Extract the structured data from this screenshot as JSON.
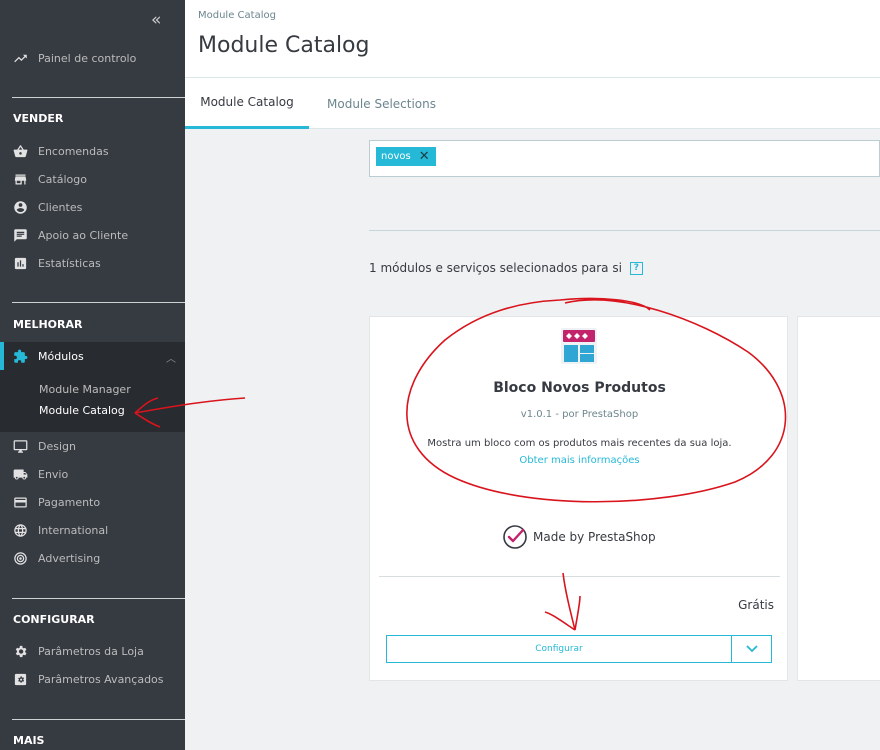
{
  "sidebar": {
    "collapse_glyph": "«",
    "dashboard": "Painel de controlo",
    "sections": {
      "sell": "VENDER",
      "improve": "MELHORAR",
      "configure": "CONFIGURAR",
      "more": "MAIS"
    },
    "sell_items": [
      "Encomendas",
      "Catálogo",
      "Clientes",
      "Apoio ao Cliente",
      "Estatísticas"
    ],
    "modules": "Módulos",
    "module_sub": [
      "Module Manager",
      "Module Catalog"
    ],
    "improve_items": [
      "Design",
      "Envio",
      "Pagamento",
      "International",
      "Advertising"
    ],
    "configure_items": [
      "Parâmetros da Loja",
      "Parâmetros Avançados"
    ],
    "icons": [
      "trending-up-icon",
      "basket-icon",
      "store-icon",
      "user-icon",
      "chat-icon",
      "chart-icon",
      "puzzle-icon",
      "monitor-icon",
      "truck-icon",
      "card-icon",
      "globe-icon",
      "target-icon",
      "gear-icon",
      "settings-box-icon"
    ]
  },
  "header": {
    "breadcrumb": "Module Catalog",
    "title": "Module Catalog"
  },
  "tabs": [
    "Module Catalog",
    "Module Selections"
  ],
  "search": {
    "tag": "novos",
    "tag_remove": "✕"
  },
  "results": {
    "count_text": "1 módulos e serviços selecionados para si",
    "help": "?"
  },
  "module": {
    "name": "Bloco Novos Produtos",
    "version": "v1.0.1 - por PrestaShop",
    "description": "Mostra um bloco com os produtos mais recentes da sua loja.",
    "more_info": "Obter mais informações",
    "made_by": "Made by PrestaShop",
    "price": "Grátis",
    "configure": "Configurar"
  },
  "colors": {
    "sidebar_bg": "#363a41",
    "accent": "#25b9d7",
    "annotation": "#d9141c"
  }
}
